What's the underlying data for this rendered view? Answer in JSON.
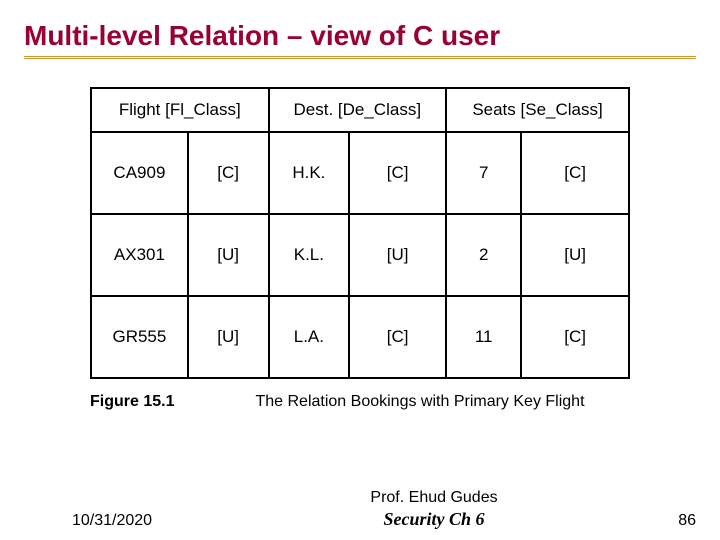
{
  "title": "Multi-level Relation – view of C user",
  "headers": {
    "flight": "Flight [Fl_Class]",
    "dest": "Dest. [De_Class]",
    "seats": "Seats [Se_Class]"
  },
  "rows": [
    {
      "flight": "CA909",
      "fl_class": "[C]",
      "dest": "H.K.",
      "de_class": "[C]",
      "seats": "7",
      "se_class": "[C]"
    },
    {
      "flight": "AX301",
      "fl_class": "[U]",
      "dest": "K.L.",
      "de_class": "[U]",
      "seats": "2",
      "se_class": "[U]"
    },
    {
      "flight": "GR555",
      "fl_class": "[U]",
      "dest": "L.A.",
      "de_class": "[C]",
      "seats": "11",
      "se_class": "[C]"
    }
  ],
  "caption": {
    "label": "Figure 15.1",
    "text": "The Relation Bookings with Primary Key Flight"
  },
  "footer": {
    "date": "10/31/2020",
    "prof": "Prof. Ehud Gudes",
    "course": "Security  Ch 6",
    "page": "86"
  }
}
